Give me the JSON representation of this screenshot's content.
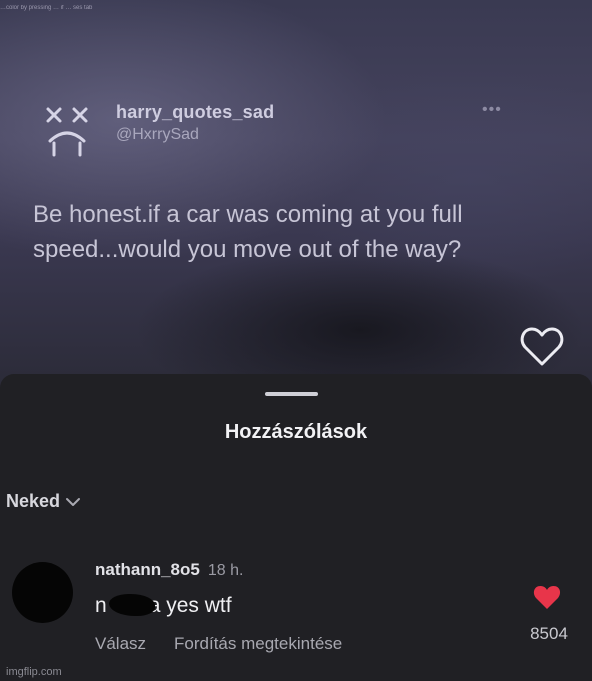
{
  "background_post": {
    "corner_note": "…color by pressing … if … ses tab",
    "user": {
      "display_name": "harry_quotes_sad",
      "handle": "@HxrrySad"
    },
    "more_glyph": "•••",
    "text": "Be honest.if a car was coming at you full speed...would you move out of the way?",
    "like_icon": "heart-outline-icon"
  },
  "comments_sheet": {
    "title": "Hozzászólások",
    "filter": {
      "label": "Neked",
      "icon": "chevron-down-icon"
    },
    "comments": [
      {
        "username": "nathann_8o5",
        "time": "18 h.",
        "text_start": "n",
        "text_end": "a yes wtf",
        "reply_label": "Válasz",
        "translate_label": "Fordítás megtekintése",
        "like_icon": "heart-filled-icon",
        "like_count": "8504",
        "like_color": "#e8354a"
      }
    ]
  },
  "watermark": "imgflip.com"
}
